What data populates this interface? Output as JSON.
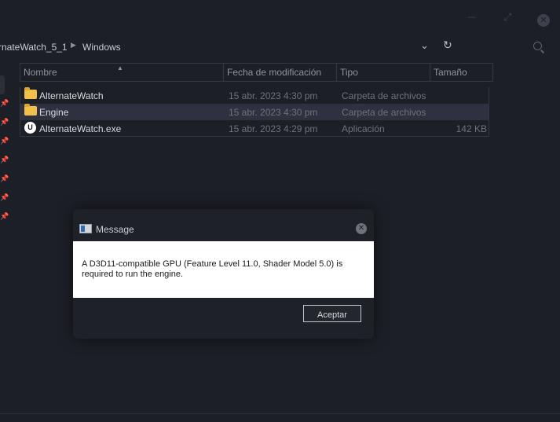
{
  "window": {
    "controls": {
      "minimize": "─",
      "maximize": "⤢",
      "close": "✕"
    }
  },
  "pathbar": {
    "crumbs": [
      "rnateWatch_5_1",
      "Windows"
    ],
    "separator": "▶",
    "dropdown_icon": "chevron-down-icon",
    "refresh_icon": "refresh-icon",
    "search_icon": "search-icon"
  },
  "sidebar": {
    "pins": [
      "📌",
      "📌",
      "📌",
      "📌",
      "📌",
      "📌",
      "📌"
    ]
  },
  "columns": {
    "name": "Nombre",
    "date": "Fecha de modificación",
    "type": "Tipo",
    "size": "Tamaño"
  },
  "files": [
    {
      "name": "AlternateWatch",
      "date": "15 abr. 2023 4:30 pm",
      "type": "Carpeta de archivos",
      "size": "",
      "icon": "folder-icon"
    },
    {
      "name": "Engine",
      "date": "15 abr. 2023 4:30 pm",
      "type": "Carpeta de archivos",
      "size": "",
      "icon": "folder-icon"
    },
    {
      "name": "AlternateWatch.exe",
      "date": "15 abr. 2023 4:29 pm",
      "type": "Aplicación",
      "size": "142 KB",
      "icon": "unreal-engine-icon",
      "icon_glyph": "U"
    }
  ],
  "dialog": {
    "title": "Message",
    "message": "A D3D11-compatible GPU (Feature Level 11.0, Shader Model 5.0) is required to run the engine.",
    "ok_label": "Aceptar",
    "close_glyph": "✕"
  }
}
